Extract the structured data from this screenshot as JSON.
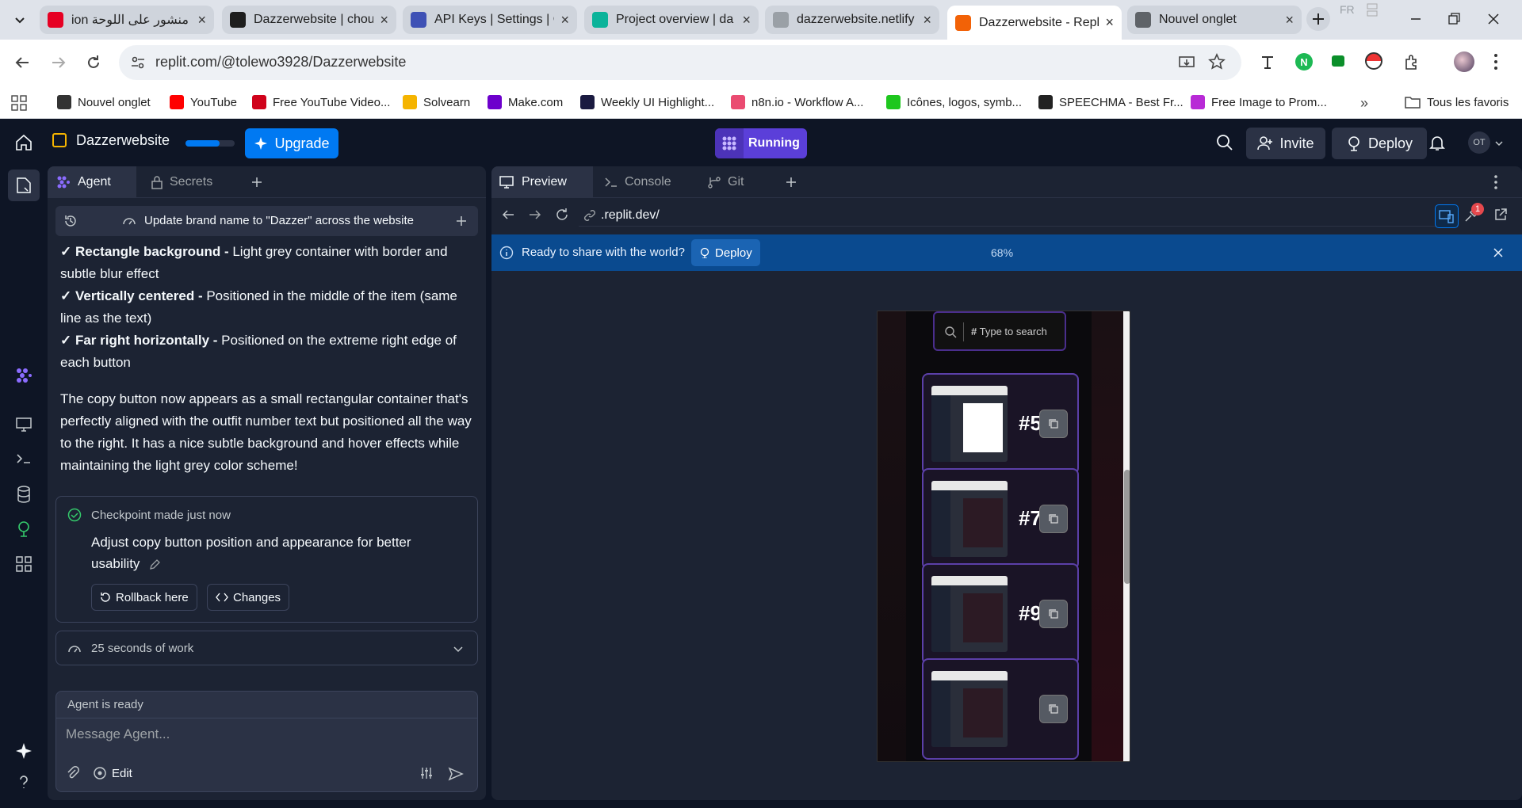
{
  "browser": {
    "tabs": [
      {
        "title": "ion منشور على اللوحة",
        "icon": "pinterest-icon",
        "color": "#e60023"
      },
      {
        "title": "Dazzerwebsite | chou",
        "icon": "bolt-icon",
        "color": "#1e1e1e"
      },
      {
        "title": "API Keys | Settings | C",
        "icon": "api-icon",
        "color": "#3f51b5"
      },
      {
        "title": "Project overview | da",
        "icon": "diamond-icon",
        "color": "#0bb39a"
      },
      {
        "title": "dazzerwebsite.netlify",
        "icon": "globe-icon",
        "color": "#9aa0a6"
      },
      {
        "title": "Dazzerwebsite - Repl",
        "icon": "replit-icon",
        "color": "#f26207"
      },
      {
        "title": "Nouvel onglet",
        "icon": "chrome-icon",
        "color": "#5f6368"
      }
    ],
    "lang_badge": "FR",
    "url": "replit.com/@tolewo3928/Dazzerwebsite",
    "bookmarks": [
      {
        "label": "Nouvel onglet",
        "color": "#333"
      },
      {
        "label": "YouTube",
        "color": "#ff0000"
      },
      {
        "label": "Free YouTube Video...",
        "color": "#d0021b"
      },
      {
        "label": "Solvearn",
        "color": "#f5b400"
      },
      {
        "label": "Make.com",
        "color": "#6d00cc"
      },
      {
        "label": "Weekly UI Highlight...",
        "color": "#1a1a40"
      },
      {
        "label": "n8n.io - Workflow A...",
        "color": "#ea4b71"
      },
      {
        "label": "Icônes, logos, symb...",
        "color": "#1ec71e"
      },
      {
        "label": "SPEECHMA - Best Fr...",
        "color": "#222"
      },
      {
        "label": "Free Image to Prom...",
        "color": "#b82ad6"
      }
    ],
    "all_bookmarks": "Tous les favoris"
  },
  "app": {
    "project_name": "Dazzerwebsite",
    "upgrade": "Upgrade",
    "status": "Running",
    "invite": "Invite",
    "deploy": "Deploy",
    "avatar": "OT",
    "accent": "#0079f2",
    "running_color": "#5b3fd9"
  },
  "left": {
    "tabs": [
      "Agent",
      "Secrets"
    ],
    "thread_title": "Update brand name to \"Dazzer\" across the website",
    "checks": [
      {
        "bold": "✓ Rectangle background -",
        "text": " Light grey container with border and subtle blur effect"
      },
      {
        "bold": "✓ Vertically centered -",
        "text": " Positioned in the middle of the item (same line as the text)"
      },
      {
        "bold": "✓ Far right horizontally -",
        "text": " Positioned on the extreme right edge of each button"
      }
    ],
    "paragraph": "The copy button now appears as a small rectangular container that's perfectly aligned with the outfit number text but positioned all the way to the right. It has a nice subtle background and hover effects while maintaining the light grey color scheme!",
    "checkpoint": {
      "label": "Checkpoint made just now",
      "desc": "Adjust copy button position and appearance for better usability",
      "rollback": "Rollback here",
      "changes": "Changes"
    },
    "work": "25 seconds of work",
    "agent_status": "Agent is ready",
    "input_placeholder": "Message Agent...",
    "edit": "Edit"
  },
  "right": {
    "tabs": [
      "Preview",
      "Console",
      "Git"
    ],
    "url": ".replit.dev/",
    "badge_count": "1",
    "banner": {
      "text": "Ready to share with the world?",
      "deploy": "Deploy",
      "zoom": "68%"
    },
    "preview": {
      "search_placeholder": "Type to search",
      "outfits": [
        "#5",
        "#7",
        "#9",
        ""
      ]
    }
  }
}
